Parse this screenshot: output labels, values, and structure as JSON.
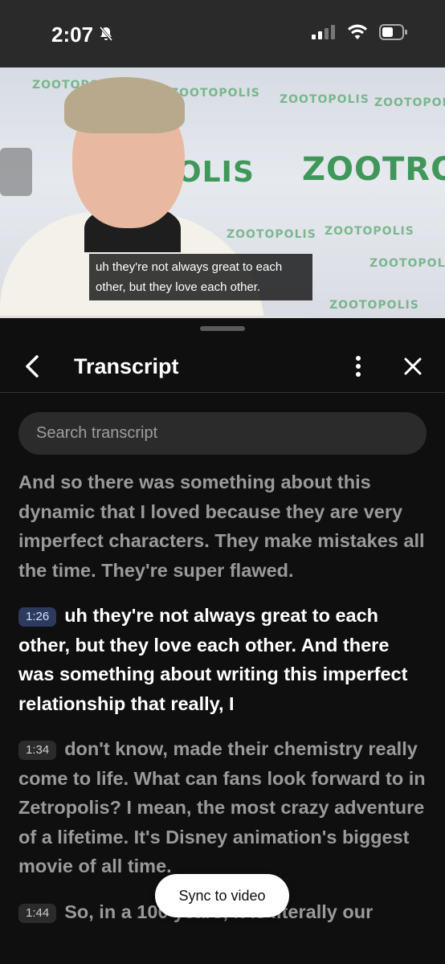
{
  "status_bar": {
    "time": "2:07"
  },
  "video": {
    "caption": "uh they're not always great to each other, but they love each other.",
    "logos": [
      "ZOOTOPOLIS",
      "ZOOTOPOLIS",
      "ZOOTOPOLIS",
      "ZOOTROPOLIS",
      "ZOOTOPOLIS",
      "ZOOTOPOLIS",
      "ZOOTOPOLIS",
      "ZOOTOPOLIS",
      "ZOOTOPOLIS"
    ]
  },
  "transcript": {
    "title": "Transcript",
    "search_placeholder": "Search transcript",
    "segments": [
      {
        "time": "",
        "text": "And so there was something about this dynamic that I loved because they are very imperfect characters. They make mistakes all the time. They're super flawed.",
        "active": false
      },
      {
        "time": "1:26",
        "text": "uh they're not always great to each other, but they love each other. And there was something about writing this imperfect relationship that really, I",
        "active": true
      },
      {
        "time": "1:34",
        "text": "don't know, made their chemistry really come to life. What can fans look forward to in Zetropolis? I mean, the most crazy adventure of a lifetime. It's Disney animation's biggest movie of all time.",
        "active": false
      },
      {
        "time": "1:44",
        "text": "So, in a 100 years, it is literally our",
        "active": false
      }
    ],
    "sync_label": "Sync to video"
  }
}
